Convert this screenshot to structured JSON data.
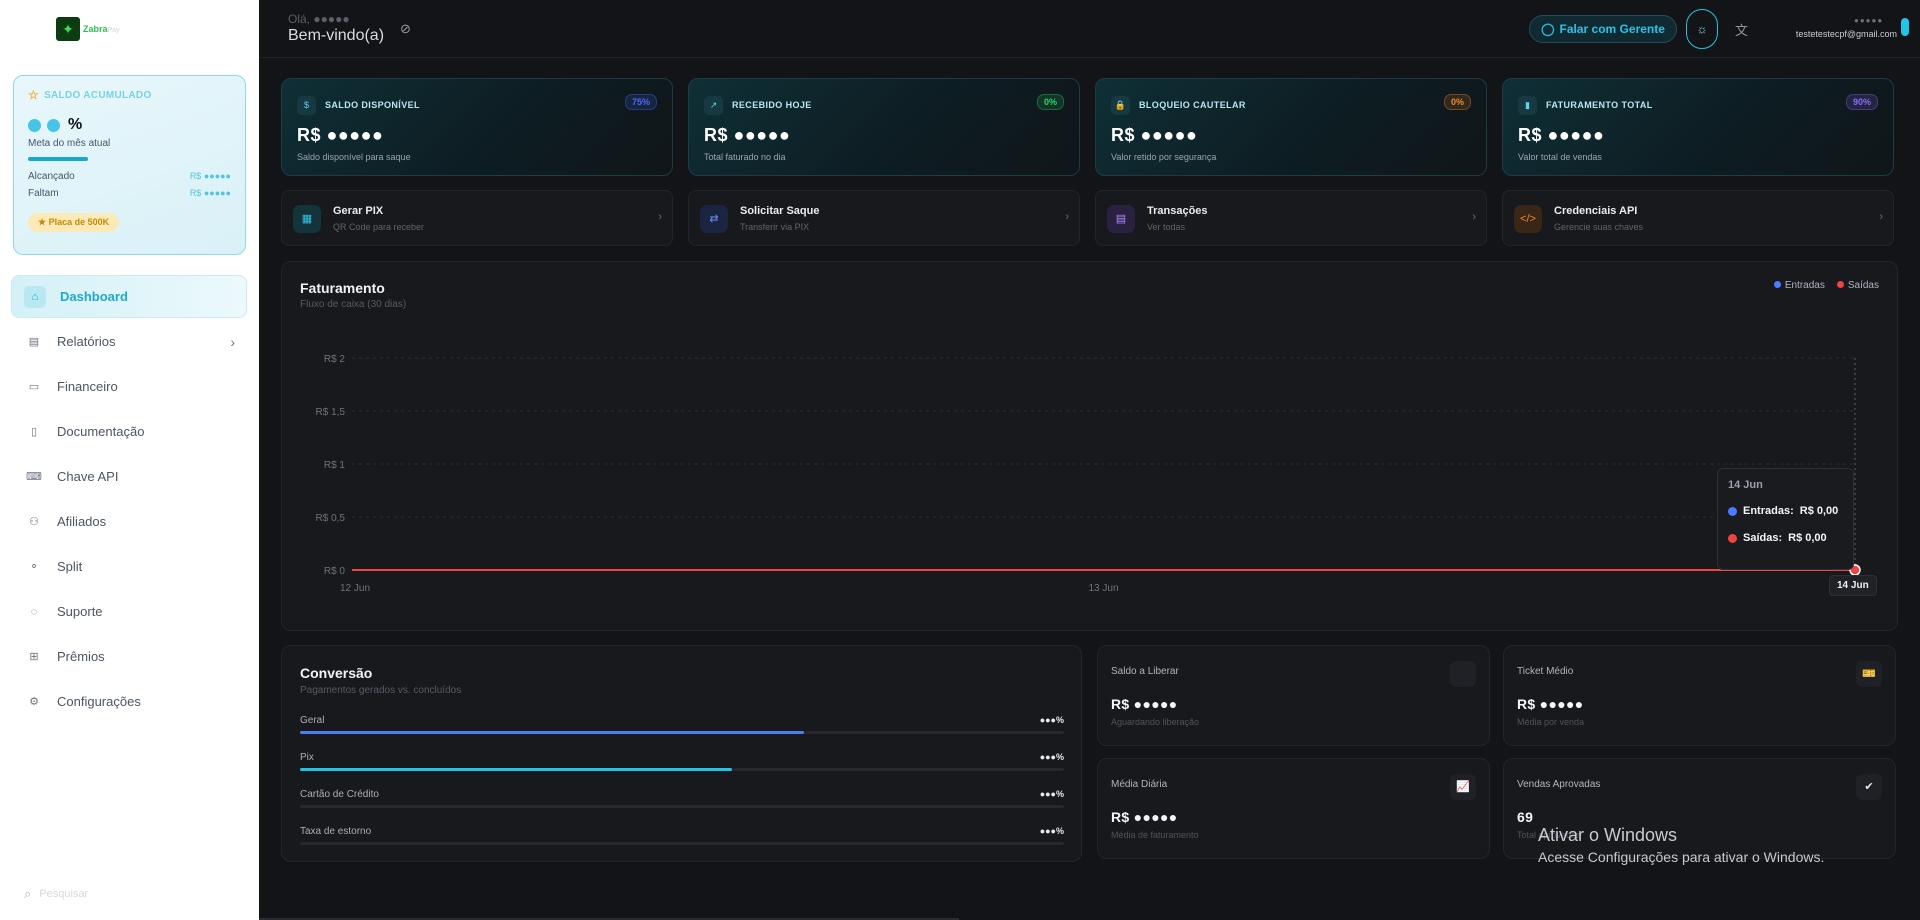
{
  "brand": {
    "name": "Zabra",
    "suffix": "Pay"
  },
  "balance_card": {
    "title": "SALDO ACUMULADO",
    "pct_suffix": "%",
    "goal_label": "Meta do mês atual",
    "reached_label": "Alcançado",
    "reached_value": "R$ ●●●●●",
    "missing_label": "Faltam",
    "missing_value": "R$ ●●●●●",
    "badge": "Placa de 500K",
    "progress": 0.2
  },
  "nav": [
    {
      "label": "Dashboard",
      "icon": "home-icon",
      "glyph": "⌂",
      "active": true
    },
    {
      "label": "Relatórios",
      "icon": "report-icon",
      "glyph": "▤",
      "chevron": "›"
    },
    {
      "label": "Financeiro",
      "icon": "wallet-icon",
      "glyph": "▭"
    },
    {
      "label": "Documentação",
      "icon": "document-icon",
      "glyph": "▯"
    },
    {
      "label": "Chave API",
      "icon": "key-icon",
      "glyph": "⌨"
    },
    {
      "label": "Afiliados",
      "icon": "affiliates-icon",
      "glyph": "⚇"
    },
    {
      "label": "Split",
      "icon": "split-icon",
      "glyph": "⚬"
    },
    {
      "label": "Suporte",
      "icon": "support-icon",
      "glyph": "◌"
    },
    {
      "label": "Prêmios",
      "icon": "gift-icon",
      "glyph": "⊞"
    },
    {
      "label": "Configurações",
      "icon": "settings-icon",
      "glyph": "⚙"
    }
  ],
  "sidebar_search": {
    "placeholder": "Pesquisar"
  },
  "header": {
    "greeting_small": "Olá, ●●●●●",
    "greeting": "Bem-vindo(a)",
    "talk_button": "Falar com Gerente",
    "user_name": "●●●●●",
    "user_email": "testetestecpf@gmail.com"
  },
  "stats": [
    {
      "label": "SALDO DISPONÍVEL",
      "value": "R$ ●●●●●",
      "sub": "Saldo disponível para saque",
      "badge": "75%",
      "badge_color": "#4b6bff",
      "icon": "dollar-icon",
      "glyph": "$"
    },
    {
      "label": "RECEBIDO HOJE",
      "value": "R$ ●●●●●",
      "sub": "Total faturado no dia",
      "badge": "0%",
      "badge_color": "#2bd46a",
      "icon": "trend-up-icon",
      "glyph": "↗"
    },
    {
      "label": "BLOQUEIO CAUTELAR",
      "value": "R$ ●●●●●",
      "sub": "Valor retido por segurança",
      "badge": "0%",
      "badge_color": "#f08a2a",
      "icon": "lock-icon",
      "glyph": "🔒"
    },
    {
      "label": "FATURAMENTO TOTAL",
      "value": "R$ ●●●●●",
      "sub": "Valor total de vendas",
      "badge": "90%",
      "badge_color": "#8b6bff",
      "icon": "bar-chart-icon",
      "glyph": "▮"
    }
  ],
  "actions": [
    {
      "title": "Gerar PIX",
      "sub": "QR Code para receber",
      "icon": "qr-code-icon",
      "glyph": "▦",
      "bg": "#14343b",
      "fg": "#36c6e6"
    },
    {
      "title": "Solicitar Saque",
      "sub": "Transferir via PIX",
      "icon": "transfer-icon",
      "glyph": "⇄",
      "bg": "#1b2440",
      "fg": "#6b8cff"
    },
    {
      "title": "Transações",
      "sub": "Ver todas",
      "icon": "receipt-icon",
      "glyph": "▤",
      "bg": "#2a2140",
      "fg": "#b08cff"
    },
    {
      "title": "Credenciais API",
      "sub": "Gerencie suas chaves",
      "icon": "code-icon",
      "glyph": "</>",
      "bg": "#3a2616",
      "fg": "#f08a2a"
    }
  ],
  "chart": {
    "title": "Faturamento",
    "subtitle": "Fluxo de caixa (30 dias)",
    "legend": [
      {
        "name": "Entradas",
        "color": "#4b7bff"
      },
      {
        "name": "Saídas",
        "color": "#ef4444"
      }
    ],
    "tooltip": {
      "date": "14 Jun",
      "in_label": "Entradas:",
      "in_value": "R$ 0,00",
      "out_label": "Saídas:",
      "out_value": "R$ 0,00"
    }
  },
  "chart_data": {
    "type": "line",
    "title": "Faturamento",
    "x": [
      "12 Jun",
      "13 Jun",
      "14 Jun"
    ],
    "series": [
      {
        "name": "Entradas",
        "values": [
          0,
          0,
          0
        ]
      },
      {
        "name": "Saídas",
        "values": [
          0,
          0,
          0
        ]
      }
    ],
    "ylim": [
      0,
      2
    ],
    "yticks": [
      "R$ 0",
      "R$ 0,5",
      "R$ 1",
      "R$ 1,5",
      "R$ 2"
    ],
    "ytick_values": [
      0,
      0.5,
      1,
      1.5,
      2
    ],
    "grid": true,
    "legend_position": "top-right"
  },
  "conversion": {
    "title": "Conversão",
    "subtitle": "Pagamentos gerados vs. concluídos",
    "rows": [
      {
        "label": "Geral",
        "value": "●●●%",
        "fill": 0.66,
        "color": "#4f7cf0"
      },
      {
        "label": "Pix",
        "value": "●●●%",
        "fill": 0.565,
        "color": "#22c4e8"
      },
      {
        "label": "Cartão de Crédito",
        "value": "●●●%",
        "fill": 0,
        "color": "#22c4e8"
      },
      {
        "label": "Taxa de estorno",
        "value": "●●●%",
        "fill": 0,
        "color": "#22c4e8"
      }
    ]
  },
  "minis": [
    {
      "title": "Saldo a Liberar",
      "value": "R$ ●●●●●",
      "sub": "Aguardando liberação",
      "icon": "hourglass-icon",
      "glyph": ""
    },
    {
      "title": "Ticket Médio",
      "value": "R$ ●●●●●",
      "sub": "Média por venda",
      "icon": "ticket-icon",
      "glyph": "🎫"
    },
    {
      "title": "Média Diária",
      "value": "R$ ●●●●●",
      "sub": "Média de faturamento",
      "icon": "chart-up-icon",
      "glyph": "📈"
    },
    {
      "title": "Vendas Aprovadas",
      "value": "69",
      "sub": "Total aprovadas",
      "icon": "check-icon",
      "glyph": "✔"
    }
  ],
  "watermark": {
    "line1": "Ativar o Windows",
    "line2": "Acesse Configurações para ativar o Windows."
  }
}
